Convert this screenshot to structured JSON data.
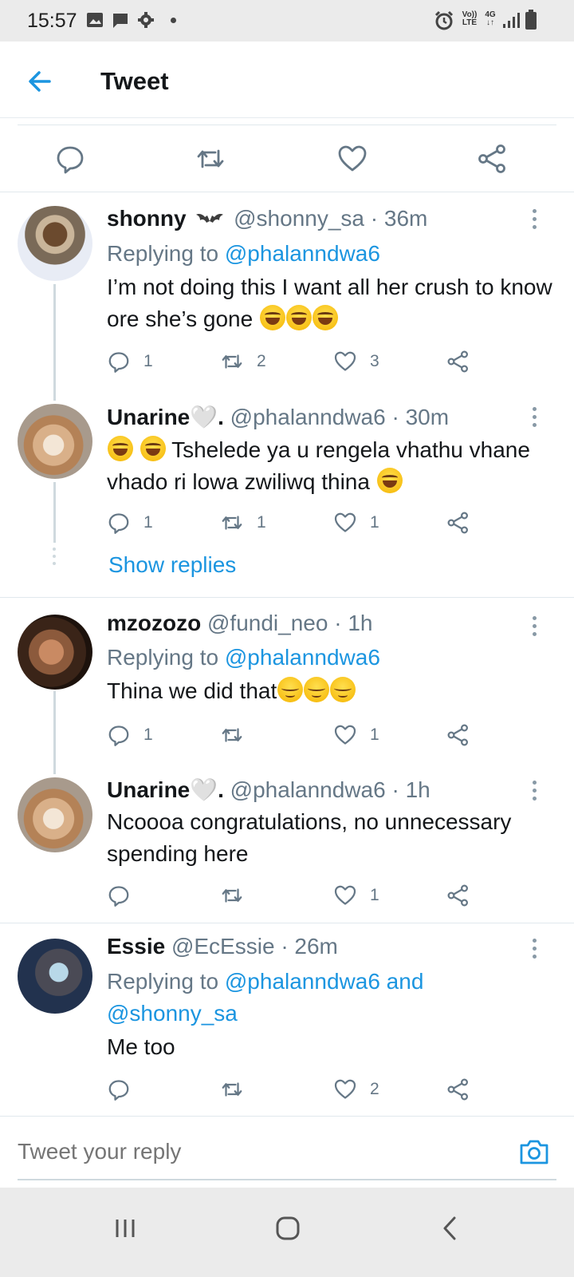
{
  "status_bar": {
    "time": "15:57",
    "notification_icons": [
      "image-icon",
      "message-icon",
      "gear-icon",
      "dot-icon"
    ],
    "right_icons": [
      "alarm-icon",
      "volte-icon",
      "4g-icon",
      "signal-icon",
      "battery-icon"
    ],
    "volte_top": "Vo))",
    "volte_bottom": "LTE",
    "network": "4G"
  },
  "header": {
    "title": "Tweet",
    "back_icon": "back-arrow-icon",
    "accent_color": "#1b95e0"
  },
  "main_actions": [
    "reply-icon",
    "retweet-icon",
    "like-icon",
    "share-icon"
  ],
  "replies": [
    {
      "name": "shonny",
      "badge_icon": "bat-icon",
      "handle": "@shonny_sa",
      "time": "· 36m",
      "replying_prefix": "Replying to",
      "replying_to": "@phalanndwa6",
      "text": "I’m not doing this I want all her crush to know ore she’s gone",
      "emoji": [
        "laughing-emoji",
        "laughing-emoji",
        "laughing-emoji"
      ],
      "reply_count": "1",
      "retweet_count": "2",
      "like_count": "3"
    },
    {
      "name": "Unarine🤍.",
      "handle": "@phalanndwa6",
      "time": "· 30m",
      "text_lead_emoji": [
        "tears-of-joy-emoji",
        "tears-of-joy-emoji"
      ],
      "text": "Tshelede ya u rengela vhathu vhane vhado ri lowa zwiliwq thina",
      "emoji": [
        "laughing-emoji"
      ],
      "reply_count": "1",
      "retweet_count": "1",
      "like_count": "1"
    },
    {
      "name": "mzozozo",
      "handle": "@fundi_neo",
      "time": "· 1h",
      "replying_prefix": "Replying to",
      "replying_to": "@phalanndwa6",
      "text": "Thina we did that",
      "emoji": [
        "relieved-emoji",
        "relieved-emoji",
        "relieved-emoji"
      ],
      "reply_count": "1",
      "retweet_count": "",
      "like_count": "1"
    },
    {
      "name": "Unarine🤍.",
      "handle": "@phalanndwa6",
      "time": "· 1h",
      "text": "Ncoooa congratulations, no unnecessary spending here",
      "reply_count": "",
      "retweet_count": "",
      "like_count": "1"
    },
    {
      "name": "Essie",
      "handle": "@EcEssie",
      "time": "· 26m",
      "replying_prefix": "Replying to",
      "replying_to": "@phalanndwa6 and @shonny_sa",
      "text": "Me too",
      "reply_count": "",
      "retweet_count": "",
      "like_count": "2"
    }
  ],
  "show_replies": "Show replies",
  "compose": {
    "placeholder": "Tweet your reply",
    "camera_icon": "camera-icon"
  },
  "nav_bar": [
    "recents-icon",
    "home-icon",
    "back-icon"
  ]
}
